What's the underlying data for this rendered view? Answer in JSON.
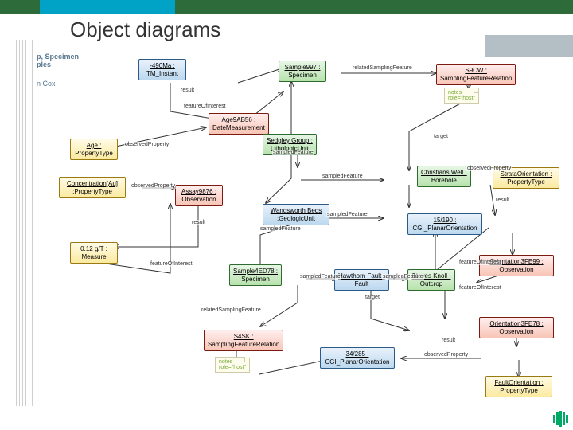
{
  "title": "Object diagrams",
  "cut_labels": {
    "top": "p, Specimen",
    "sub": "ples",
    "author": "n Cox"
  },
  "edge_labels": {
    "result": "result",
    "featureOfInterest": "featureOfInterest",
    "observedProperty": "observedProperty",
    "sampledFeature": "sampledFeature",
    "relatedSamplingFeature": "relatedSamplingFeature",
    "target": "target",
    "notes": "notes"
  },
  "notes": {
    "role_host": "role=\"host\""
  },
  "nodes": {
    "tm_instant": {
      "name": "-490Ma :",
      "type": "TM_Instant"
    },
    "specimen997": {
      "name": "Sample997 :",
      "type": "Specimen"
    },
    "sfr_s9cw": {
      "name": "S9CW :",
      "type": "SamplingFeatureRelation"
    },
    "age_prop": {
      "name": "Age :",
      "type": "PropertyType"
    },
    "date_meas": {
      "name": "Age9AB56 :",
      "type": "DateMeasurement"
    },
    "conc_au": {
      "name": "Concentration[Au]",
      "type": ":PropertyType"
    },
    "assay": {
      "name": "Assay9876 :",
      "type": "Observation"
    },
    "sedgley": {
      "name": "Sedgley Group :",
      "type": "LithologicUnit"
    },
    "borehole": {
      "name": "Christians Well :",
      "type": "Borehole"
    },
    "strata_prop": {
      "name": "StrataOrientation :",
      "type": "PropertyType"
    },
    "wandsworth": {
      "name": "Wandsworth Beds",
      "type": ":GeologicUnit"
    },
    "planar1": {
      "name": "15/190 :",
      "type": "CGI_PlanarOrientation"
    },
    "measure": {
      "name": "0.12 g/T :",
      "type": "Measure"
    },
    "obs3fe99": {
      "name": "Orientation3FE99 :",
      "type": "Observation"
    },
    "sample_ed78": {
      "name": "Sample4ED78 :",
      "type": "Specimen"
    },
    "hawthorn": {
      "name": "Hawthorn Fault :",
      "type": "Fault"
    },
    "outcrop": {
      "name": "Steves Knoll :",
      "type": "Outcrop"
    },
    "obs3fe78": {
      "name": "Orientation3FE78 :",
      "type": "Observation"
    },
    "sfr_s4sk": {
      "name": "S4SK :",
      "type": "SamplingFeatureRelation"
    },
    "planar2": {
      "name": "34/285 :",
      "type": "CGI_PlanarOrientation"
    },
    "fault_prop": {
      "name": "FaultOrientation :",
      "type": "PropertyType"
    }
  }
}
